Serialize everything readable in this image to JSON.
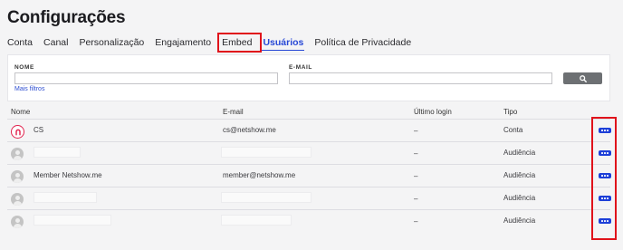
{
  "page": {
    "title": "Configurações"
  },
  "tabs": [
    {
      "label": "Conta"
    },
    {
      "label": "Canal"
    },
    {
      "label": "Personalização"
    },
    {
      "label": "Engajamento"
    },
    {
      "label": "Embed"
    },
    {
      "label": "Usuários",
      "active": true
    },
    {
      "label": "Política de Privacidade"
    }
  ],
  "filters": {
    "name_label": "NOME",
    "name_value": "",
    "email_label": "E-MAIL",
    "email_value": "",
    "more_filters": "Mais filtros",
    "search_icon": "search-icon"
  },
  "table": {
    "headers": {
      "name": "Nome",
      "email": "E-mail",
      "last_login": "Último login",
      "type": "Tipo"
    },
    "rows": [
      {
        "name": "CS",
        "email": "cs@netshow.me",
        "last_login": "–",
        "type": "Conta",
        "avatar": "netshow-logo"
      },
      {
        "name": "",
        "email": "",
        "last_login": "–",
        "type": "Audiência",
        "avatar": "user-placeholder"
      },
      {
        "name": "Member Netshow.me",
        "email": "member@netshow.me",
        "last_login": "–",
        "type": "Audiência",
        "avatar": "user-placeholder"
      },
      {
        "name": "",
        "email": "",
        "last_login": "–",
        "type": "Audiência",
        "avatar": "user-placeholder"
      },
      {
        "name": "",
        "email": "",
        "last_login": "–",
        "type": "Audiência",
        "avatar": "user-placeholder"
      }
    ],
    "action_icon": "more-dots-icon"
  },
  "colors": {
    "accent": "#2748d6",
    "highlight": "#e0131b",
    "action_button": "#1d3fd8",
    "logo": "#e1234e"
  }
}
